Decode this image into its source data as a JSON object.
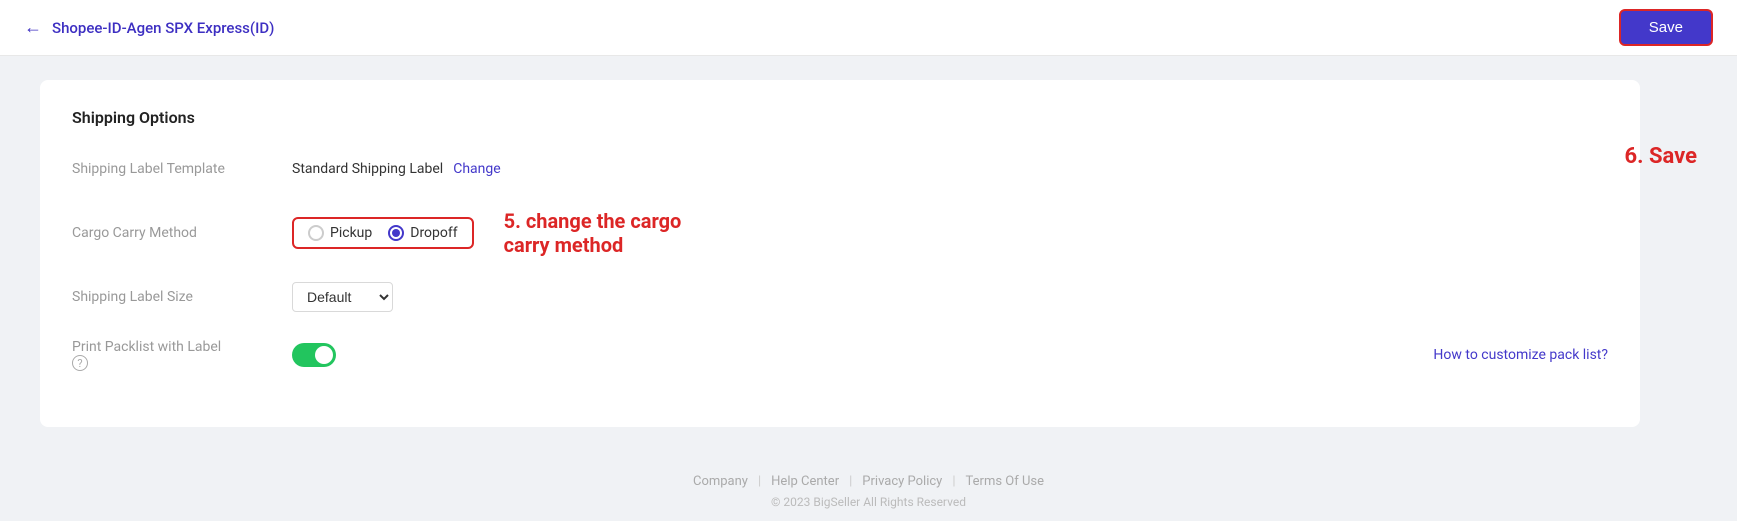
{
  "header": {
    "back_label": "Shopee-ID-Agen SPX Express(ID)",
    "save_label": "Save"
  },
  "annotation": {
    "save": "6. Save",
    "cargo": "5. change the cargo\ncarry method"
  },
  "card": {
    "title": "Shipping Options",
    "rows": {
      "shipping_label_template": {
        "label": "Shipping Label Template",
        "value": "Standard Shipping Label",
        "change_link": "Change"
      },
      "cargo_carry_method": {
        "label": "Cargo Carry Method",
        "options": [
          "Pickup",
          "Dropoff"
        ],
        "selected": "Dropoff"
      },
      "shipping_label_size": {
        "label": "Shipping Label Size",
        "selected": "Default",
        "options": [
          "Default"
        ]
      },
      "print_packlist": {
        "label": "Print Packlist with Label",
        "enabled": true,
        "customize_link": "How to customize pack list?"
      }
    }
  },
  "footer": {
    "links": [
      "Company",
      "Help Center",
      "Privacy Policy",
      "Terms Of Use"
    ],
    "copyright": "© 2023 BigSeller All Rights Reserved"
  }
}
